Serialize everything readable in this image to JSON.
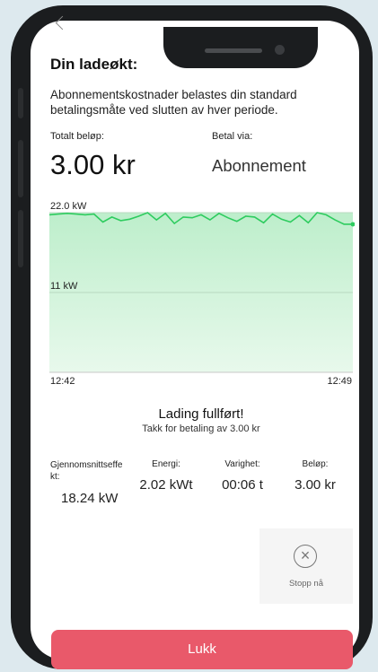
{
  "screen": {
    "title": "Din ladeøkt:",
    "description": "Abonnementskostnader belastes din standard betalingsmåte ved slutten av hver periode."
  },
  "summary": {
    "total_label": "Totalt beløp:",
    "total_value": "3.00 kr",
    "pay_label": "Betal via:",
    "pay_value": "Abonnement"
  },
  "chart_data": {
    "type": "area",
    "ylabel_top": "22.0 kW",
    "ylabel_mid": "11 kW",
    "x_start": "12:42",
    "x_end": "12:49",
    "ylim": [
      0,
      22.0
    ],
    "line_color": "#2ecc5f",
    "fill_color": "#cdf2d6",
    "values": [
      21.7,
      21.8,
      21.9,
      21.8,
      21.7,
      21.8,
      20.7,
      21.4,
      20.9,
      21.1,
      21.5,
      22.0,
      21.0,
      21.9,
      20.5,
      21.4,
      21.3,
      21.7,
      21.0,
      21.9,
      21.3,
      20.8,
      21.5,
      21.4,
      20.6,
      21.8,
      21.1,
      20.7,
      21.6,
      20.6,
      22.0,
      21.7,
      21.0,
      20.4,
      20.4
    ]
  },
  "status": {
    "title": "Lading fullført!",
    "subtitle": "Takk for betaling av 3.00 kr"
  },
  "stats": {
    "avg_label": "Gjennomsnittseffe kt:",
    "avg_value": "18.24 kW",
    "energy_label": "Energi:",
    "energy_value": "2.02 kWt",
    "duration_label": "Varighet:",
    "duration_value": "00:06 t",
    "amount_label": "Beløp:",
    "amount_value": "3.00 kr"
  },
  "actions": {
    "stop_icon": "close-circle-icon",
    "stop_label": "Stopp nå",
    "close_label": "Lukk"
  }
}
